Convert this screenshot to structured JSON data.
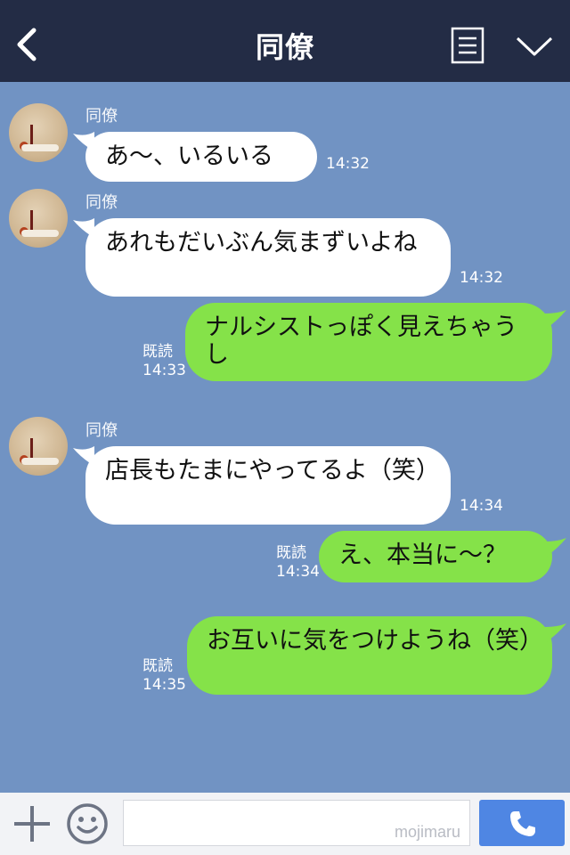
{
  "header": {
    "title": "同僚"
  },
  "messages": [
    {
      "side": "in",
      "sender": "同僚",
      "text": "あ〜、いるいる",
      "time": "14:32"
    },
    {
      "side": "in",
      "sender": "同僚",
      "text": "あれもだいぶん気まずいよね",
      "time": "14:32"
    },
    {
      "side": "out",
      "read": "既読",
      "text": "ナルシストっぽく見えちゃうし",
      "time": "14:33"
    },
    {
      "side": "in",
      "sender": "同僚",
      "text": "店長もたまにやってるよ（笑）",
      "time": "14:34"
    },
    {
      "side": "out",
      "read": "既読",
      "text": "え、本当に〜？",
      "time": "14:34"
    },
    {
      "side": "out",
      "read": "既読",
      "text": "お互いに気をつけようね（笑）",
      "time": "14:35"
    }
  ],
  "footer": {
    "watermark": "mojimaru"
  },
  "colors": {
    "header_bg": "#232c45",
    "chat_bg": "#7193c3",
    "incoming_bubble": "#ffffff",
    "outgoing_bubble": "#85e249",
    "send_button": "#4f86e3"
  },
  "icons": [
    "back-arrow-icon",
    "notes-icon",
    "chevron-down-icon",
    "plus-icon",
    "smile-icon",
    "phone-icon"
  ]
}
